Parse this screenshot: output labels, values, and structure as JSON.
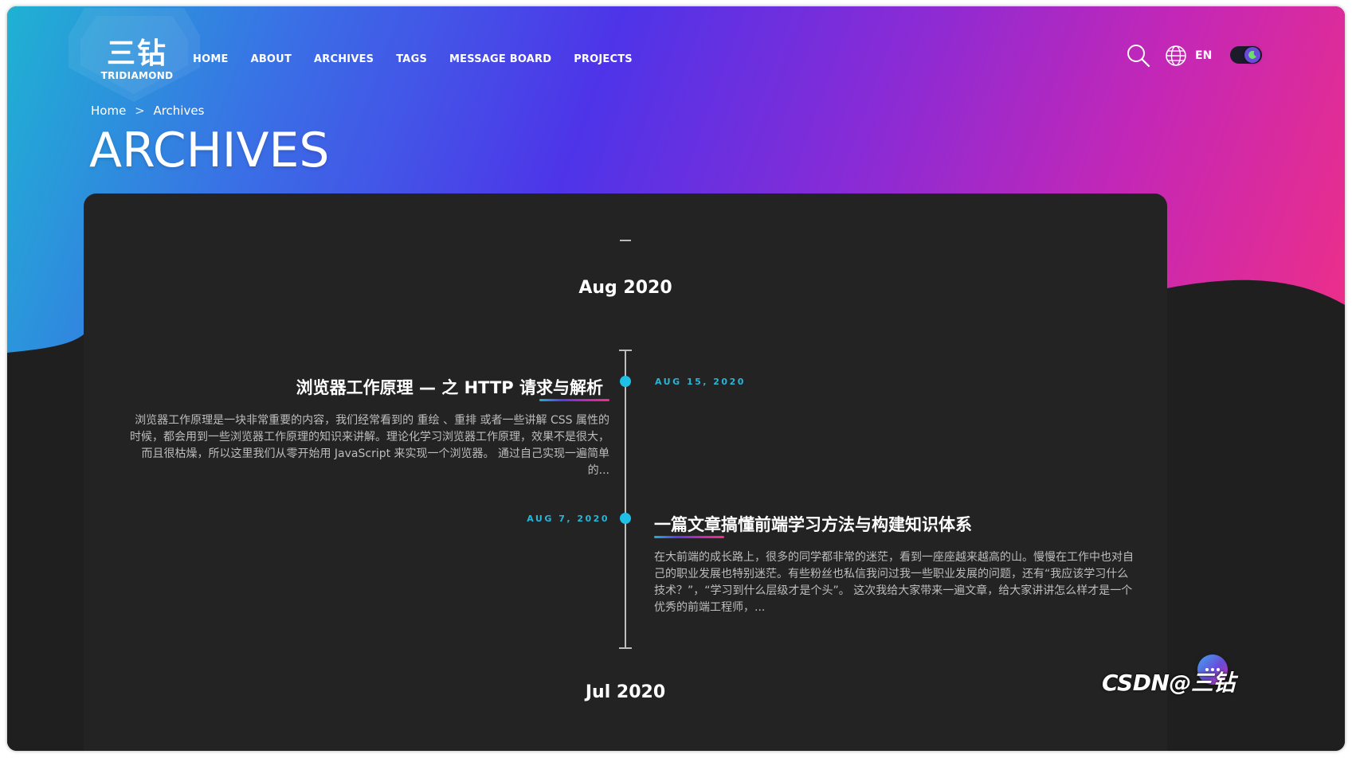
{
  "brand": {
    "logo_cn": "三钻",
    "logo_en": "TRIDIAMOND"
  },
  "nav": {
    "items": [
      {
        "label": "HOME"
      },
      {
        "label": "ABOUT"
      },
      {
        "label": "ARCHIVES"
      },
      {
        "label": "TAGS"
      },
      {
        "label": "MESSAGE BOARD"
      },
      {
        "label": "PROJECTS"
      }
    ]
  },
  "toolbar": {
    "search_icon": "search-icon",
    "language_icon": "globe-icon",
    "language": "EN",
    "theme_toggle_icon": "moon-icon"
  },
  "breadcrumb": {
    "home": "Home",
    "separator": ">",
    "current": "Archives"
  },
  "page": {
    "title": "ARCHIVES"
  },
  "archives": {
    "groups": [
      {
        "month": "Aug 2020",
        "posts": [
          {
            "date": "AUG 15, 2020",
            "title": "浏览器工作原理 — 之 HTTP 请求与解析",
            "excerpt": "浏览器工作原理是一块非常重要的内容，我们经常看到的 重绘 、重排 或者一些讲解 CSS 属性的时候，都会用到一些浏览器工作原理的知识来讲解。理论化学习浏览器工作原理，效果不是很大，而且很枯燥，所以这里我们从零开始用 JavaScript 来实现一个浏览器。 通过自己实现一遍简单的..."
          },
          {
            "date": "AUG 7, 2020",
            "title": "一篇文章搞懂前端学习方法与构建知识体系",
            "excerpt": "在大前端的成长路上，很多的同学都非常的迷茫，看到一座座越来越高的山。慢慢在工作中也对自己的职业发展也特别迷茫。有些粉丝也私信我问过我一些职业发展的问题，还有“我应该学习什么技术？”，“学习到什么层级才是个头”。 这次我给大家带来一遍文章，给大家讲讲怎么样才是一个优秀的前端工程师，..."
          }
        ]
      },
      {
        "month": "Jul 2020"
      }
    ]
  },
  "chat": {
    "icon": "chat-icon"
  },
  "watermark": "CSDN@三钻",
  "colors": {
    "gradient": [
      "#1fb2d3",
      "#4e34e8",
      "#8a2bd5",
      "#ef2f86"
    ],
    "card_bg": "#232323",
    "date_accent": "#27b6d8",
    "timeline": "#bdbdbd"
  }
}
